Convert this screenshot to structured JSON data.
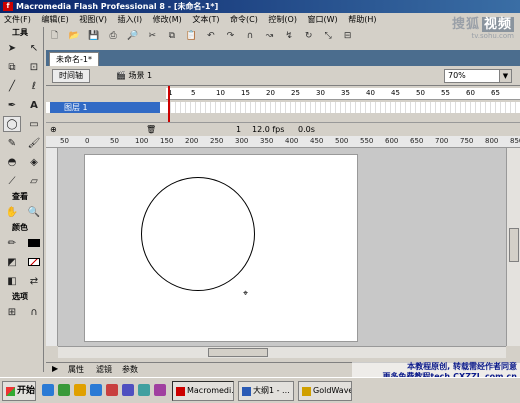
{
  "window": {
    "title": "Macromedia Flash Professional 8 - [未命名-1*]"
  },
  "menu": [
    "文件(F)",
    "编辑(E)",
    "视图(V)",
    "插入(I)",
    "修改(M)",
    "文本(T)",
    "命令(C)",
    "控制(O)",
    "窗口(W)",
    "帮助(H)"
  ],
  "watermark": {
    "brand": "搜狐",
    "video": "视频",
    "url": "tv.sohu.com"
  },
  "tools": {
    "header": "工具",
    "view_header": "查看",
    "color_header": "颜色",
    "options_header": "选项"
  },
  "document": {
    "tab": "未命名-1*"
  },
  "editbar": {
    "timeline_button": "时间轴",
    "scene": "场景 1",
    "zoom": "70%"
  },
  "timeline": {
    "layer_name": "图层 1",
    "frame_numbers": [
      "1",
      "5",
      "10",
      "15",
      "20",
      "25",
      "30",
      "35",
      "40",
      "45",
      "50",
      "55",
      "60",
      "65"
    ],
    "current_frame": "1",
    "fps": "12.0 fps",
    "time": "0.0s"
  },
  "ruler": {
    "ticks": [
      "50",
      "0",
      "50",
      "100",
      "150",
      "200",
      "250",
      "300",
      "350",
      "400",
      "450",
      "500",
      "550",
      "600",
      "650",
      "700",
      "750",
      "800",
      "850"
    ]
  },
  "panels": {
    "properties": "属性",
    "filters": "滤镜",
    "parameters": "参数"
  },
  "credits": {
    "line1": "本教程原创, 转载需经作者同意",
    "line2": "更多免费教程tech.CXZZL.com.cn"
  },
  "taskbar": {
    "start": "开始",
    "tasks": [
      "Macromedi...",
      "大纲1 - ...",
      "GoldWave"
    ]
  },
  "colors": {
    "title_start": "#0a246a",
    "title_end": "#3a6ea5",
    "doc_tab_bar": "#4b6d8e",
    "layer_selected": "#316ac5",
    "playhead": "#cc0000",
    "credits_text": "#0b1a8a"
  }
}
